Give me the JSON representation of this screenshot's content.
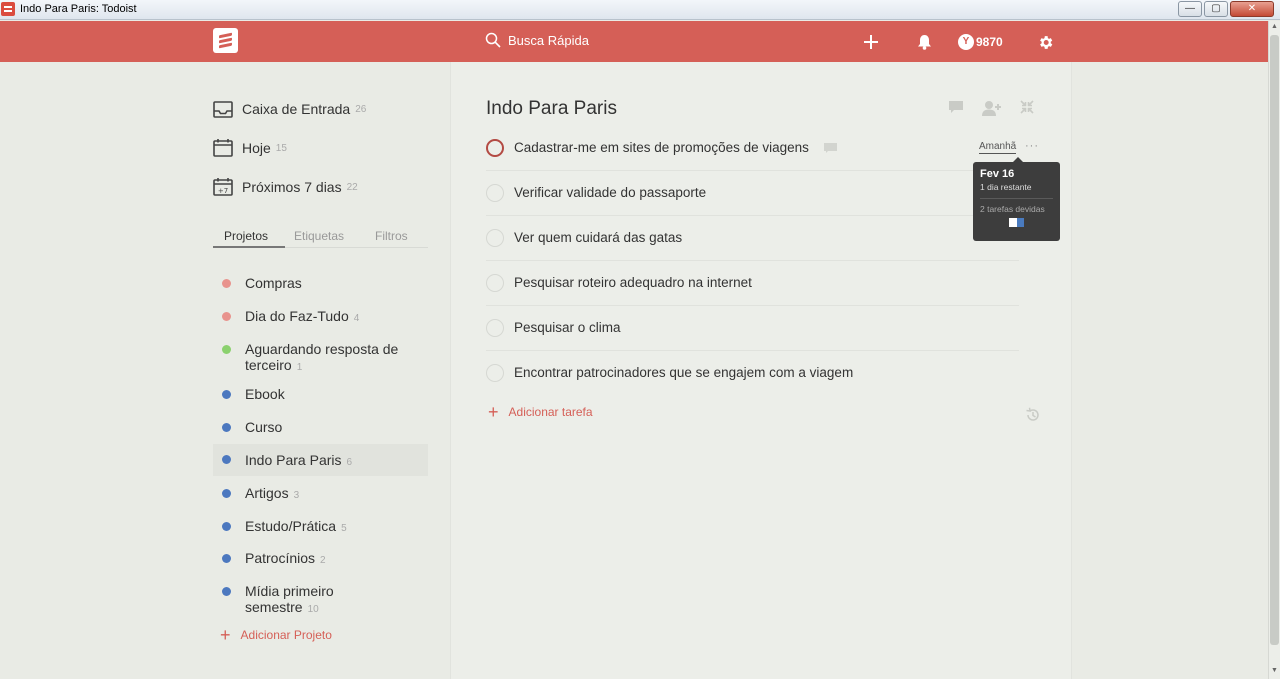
{
  "window": {
    "title": "Indo Para Paris: Todoist",
    "minimize": "—",
    "maximize": "▢",
    "close": "✕"
  },
  "topbar": {
    "search_placeholder": "Busca Rápida",
    "karma": "9870",
    "karma_badge": "Y"
  },
  "sidebar": {
    "filters": [
      {
        "label": "Caixa de Entrada",
        "count": "26",
        "icon": "inbox-icon"
      },
      {
        "label": "Hoje",
        "count": "15",
        "icon": "calendar-icon"
      },
      {
        "label": "Próximos 7 dias",
        "count": "22",
        "icon": "calendar-week-icon"
      }
    ],
    "tabs": [
      "Projetos",
      "Etiquetas",
      "Filtros"
    ],
    "projects": [
      {
        "name": "Compras",
        "count": "",
        "color": "#e8938d"
      },
      {
        "name": "Dia do Faz-Tudo",
        "count": "4",
        "color": "#e8938d"
      },
      {
        "name": "Aguardando resposta de terceiro",
        "count": "1",
        "color": "#8bd16e"
      },
      {
        "name": "Ebook",
        "count": "",
        "color": "#4c78bf"
      },
      {
        "name": "Curso",
        "count": "",
        "color": "#4c78bf"
      },
      {
        "name": "Indo Para Paris",
        "count": "6",
        "color": "#4c78bf",
        "selected": true
      },
      {
        "name": "Artigos",
        "count": "3",
        "color": "#4c78bf"
      },
      {
        "name": "Estudo/Prática",
        "count": "5",
        "color": "#4c78bf"
      },
      {
        "name": "Patrocínios",
        "count": "2",
        "color": "#4c78bf"
      },
      {
        "name": "Mídia primeiro semestre",
        "count": "10",
        "color": "#4c78bf"
      }
    ],
    "add_project": "Adicionar Projeto"
  },
  "main": {
    "title": "Indo Para Paris",
    "tasks": [
      {
        "text": "Cadastrar-me em sites de promoções de viagens",
        "due": "Amanhã",
        "has_comment": true
      },
      {
        "text": "Verificar validade do passaporte"
      },
      {
        "text": "Ver quem cuidará das gatas"
      },
      {
        "text": "Pesquisar roteiro adequadro na internet"
      },
      {
        "text": "Pesquisar o clima"
      },
      {
        "text": "Encontrar patrocinadores que se engajem com a viagem"
      }
    ],
    "more": "···",
    "add_task": "Adicionar tarefa"
  },
  "tooltip": {
    "date": "Fev 16",
    "remaining": "1 dia restante",
    "tasks_due": "2 tarefas devidas"
  },
  "colors": {
    "brand": "#d55f57",
    "background": "#e9ebe5"
  }
}
